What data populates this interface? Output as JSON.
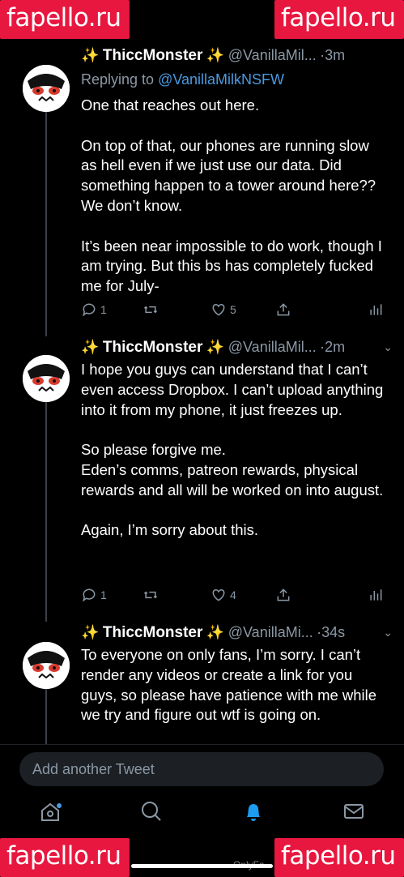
{
  "watermark": "fapello.ru",
  "tweets": [
    {
      "sparkle": "✨",
      "name": "ThiccMonster",
      "handle": "@VanillaMil...",
      "time": "·3m",
      "reply_prefix": "Replying to ",
      "reply_to": "@VanillaMilkNSFW",
      "text": "One that reaches out here.\n\nOn top of that, our phones are running slow as hell even if we just use our data. Did something happen to a tower around here?? We don’t know.\n\nIt’s been near impossible to do work, though I am trying. But this bs has completely fucked me for July-",
      "replies": "1",
      "likes": "5"
    },
    {
      "sparkle": "✨",
      "name": "ThiccMonster",
      "handle": "@VanillaMil...",
      "time": "·2m",
      "text": "I hope you guys can understand that I can’t even access Dropbox. I can’t upload anything into it from my phone, it just freezes up.\n\nSo please forgive me.\nEden’s comms, patreon rewards, physical rewards and all will be worked on into august.\n\nAgain, I’m sorry about this.",
      "replies": "1",
      "likes": "4"
    },
    {
      "sparkle": "✨",
      "name": "ThiccMonster",
      "handle": "@VanillaMi...",
      "time": "·34s",
      "text": "To everyone on only fans, I’m sorry. I can’t render any videos or create a link for you guys, so please have patience with me while we try and figure out wtf is going on."
    }
  ],
  "compose": {
    "placeholder": "Add another Tweet"
  },
  "tabs": [
    "home-icon",
    "search-icon",
    "notifications-icon",
    "messages-icon"
  ],
  "bottom_text": "OnlyFa",
  "colors": {
    "accent": "#4a9ae0",
    "muted": "#8b98a5",
    "watermark": "#e8173f"
  }
}
